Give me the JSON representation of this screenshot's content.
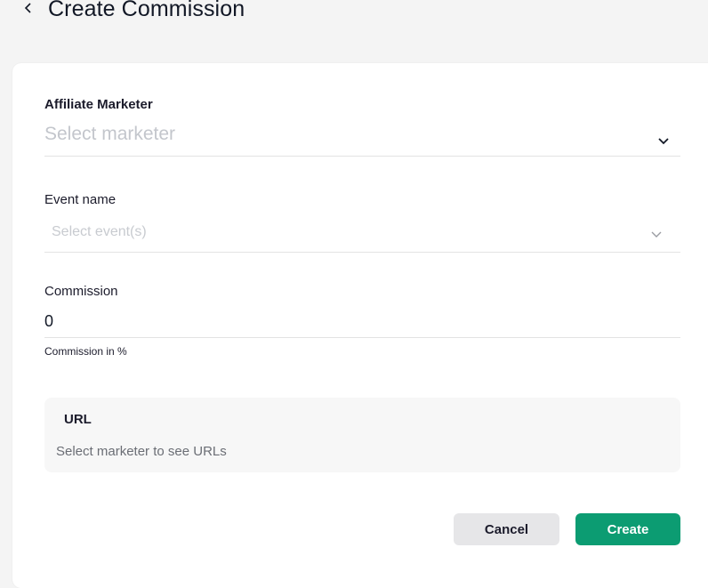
{
  "header": {
    "title": "Create Commission"
  },
  "form": {
    "marketer": {
      "label": "Affiliate Marketer",
      "placeholder": "Select marketer"
    },
    "event": {
      "label": "Event name",
      "placeholder": "Select event(s)"
    },
    "commission": {
      "label": "Commission",
      "value": "0",
      "helper": "Commission in %"
    },
    "url": {
      "title": "URL",
      "message": "Select marketer to see URLs"
    }
  },
  "actions": {
    "cancel_label": "Cancel",
    "create_label": "Create"
  },
  "colors": {
    "primary": "#0c9c72",
    "cancel_bg": "#e6e6e8",
    "page_bg": "#f4f4f4"
  },
  "icons": {
    "back": "chevron-left-icon",
    "dropdown": "chevron-down-icon"
  }
}
